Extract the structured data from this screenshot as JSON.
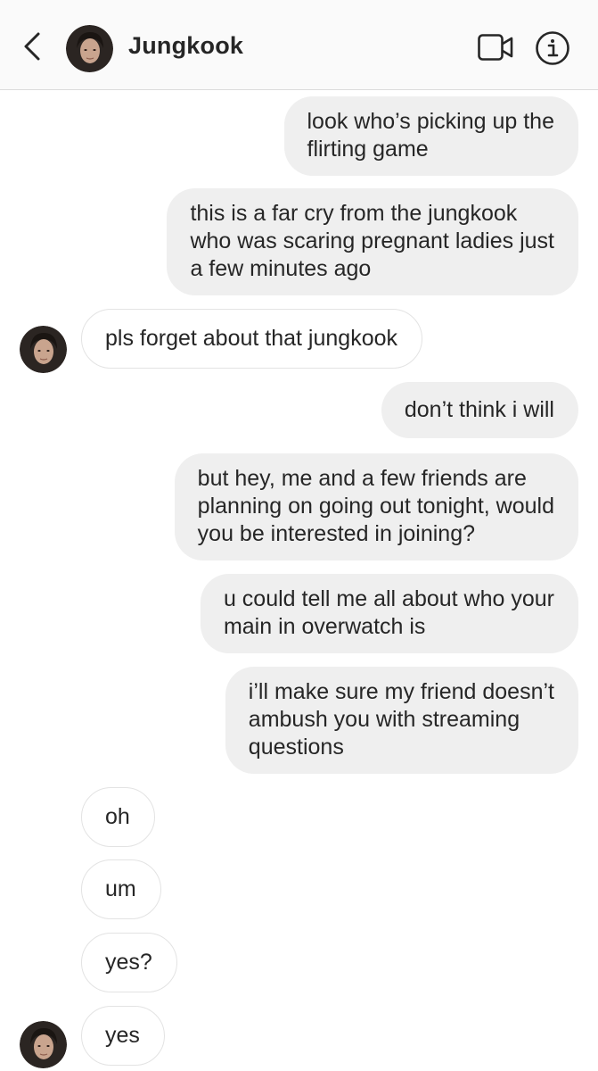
{
  "header": {
    "contact_name": "Jungkook",
    "back_icon": "chevron-left-icon",
    "video_icon": "video-camera-icon",
    "info_icon": "info-icon"
  },
  "colors": {
    "sent_bubble": "#efefef",
    "received_bubble_border": "#e3e3e3",
    "text": "#262626",
    "header_bg": "#fafafa"
  },
  "messages": [
    {
      "sender": "me",
      "lines": [
        "look who’s picking up the",
        "flirting game"
      ]
    },
    {
      "sender": "me",
      "lines": [
        "this is a far cry from the jungkook",
        "who was scaring pregnant ladies just",
        "a few minutes ago"
      ]
    },
    {
      "sender": "them",
      "lines": [
        "pls forget about that jungkook"
      ]
    },
    {
      "sender": "me",
      "lines": [
        "don’t think i will"
      ]
    },
    {
      "sender": "me",
      "lines": [
        "but hey, me and a few friends are",
        "planning on going out tonight, would",
        "you be interested in joining?"
      ]
    },
    {
      "sender": "me",
      "lines": [
        "u could tell me all about who your",
        "main in overwatch is"
      ]
    },
    {
      "sender": "me",
      "lines": [
        "i’ll make sure my friend doesn’t",
        "ambush you with streaming",
        "questions"
      ]
    },
    {
      "sender": "them",
      "lines": [
        "oh"
      ]
    },
    {
      "sender": "them",
      "lines": [
        "um"
      ]
    },
    {
      "sender": "them",
      "lines": [
        "yes?"
      ]
    },
    {
      "sender": "them",
      "lines": [
        "yes"
      ]
    }
  ]
}
